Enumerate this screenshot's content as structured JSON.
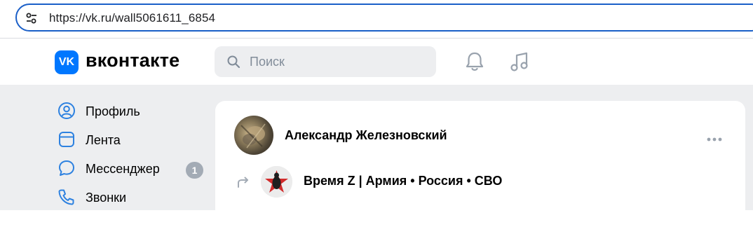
{
  "browser": {
    "url": "https://vk.ru/wall5061611_6854",
    "icons": {
      "site_settings": "tune-icon"
    }
  },
  "header": {
    "logo_mark": "VK",
    "logo_text": "вконтакте",
    "search_placeholder": "Поиск",
    "icons": [
      "search-icon",
      "bell-icon",
      "music-icon"
    ],
    "accent_color": "#0077ff"
  },
  "sidebar": {
    "items": [
      {
        "label": "Профиль",
        "icon": "profile-icon"
      },
      {
        "label": "Лента",
        "icon": "feed-icon"
      },
      {
        "label": "Мессенджер",
        "icon": "messenger-icon",
        "count": "1"
      },
      {
        "label": "Звонки",
        "icon": "phone-icon"
      }
    ]
  },
  "post": {
    "author": "Александр Железновский",
    "repost_source": "Время Z | Армия • Россия • СВО",
    "icons": [
      "more-dots-icon",
      "repost-icon"
    ]
  }
}
